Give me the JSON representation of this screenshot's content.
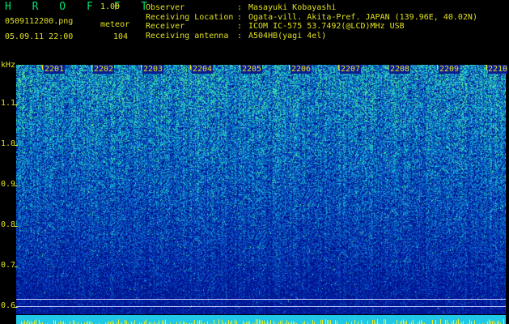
{
  "header": {
    "logo": "H R O F F T",
    "version": "1.00",
    "filename": "0509112200.png",
    "datetime": "05.09.11 22:00",
    "meteor_label": "meteor",
    "meteor_count": "104"
  },
  "info": {
    "rows": [
      {
        "key": "Observer",
        "value": "Masayuki Kobayashi"
      },
      {
        "key": "Receiving Location",
        "value": "Ogata-vill. Akita-Pref. JAPAN (139.96E, 40.02N)"
      },
      {
        "key": "Receiver",
        "value": "ICOM IC-575 53.7492(@LCD)MHz USB"
      },
      {
        "key": "Receiving antenna",
        "value": "A504HB(yagi 4el)"
      }
    ]
  },
  "axis": {
    "unit": "kHz",
    "y_labels": [
      "1.1",
      "1.0",
      "0.9",
      "0.8",
      "0.7",
      "0.6"
    ],
    "time_labels": [
      "2201",
      "2202",
      "2203",
      "2204",
      "2205",
      "2206",
      "2207",
      "2208",
      "2209",
      "2210"
    ]
  },
  "colors": {
    "text": "#e0e020",
    "logo": "#00e070",
    "spectrum_low": "#0a1e90",
    "spectrum_high": "#40e0a0",
    "bottom_band": "#20c8e8"
  }
}
